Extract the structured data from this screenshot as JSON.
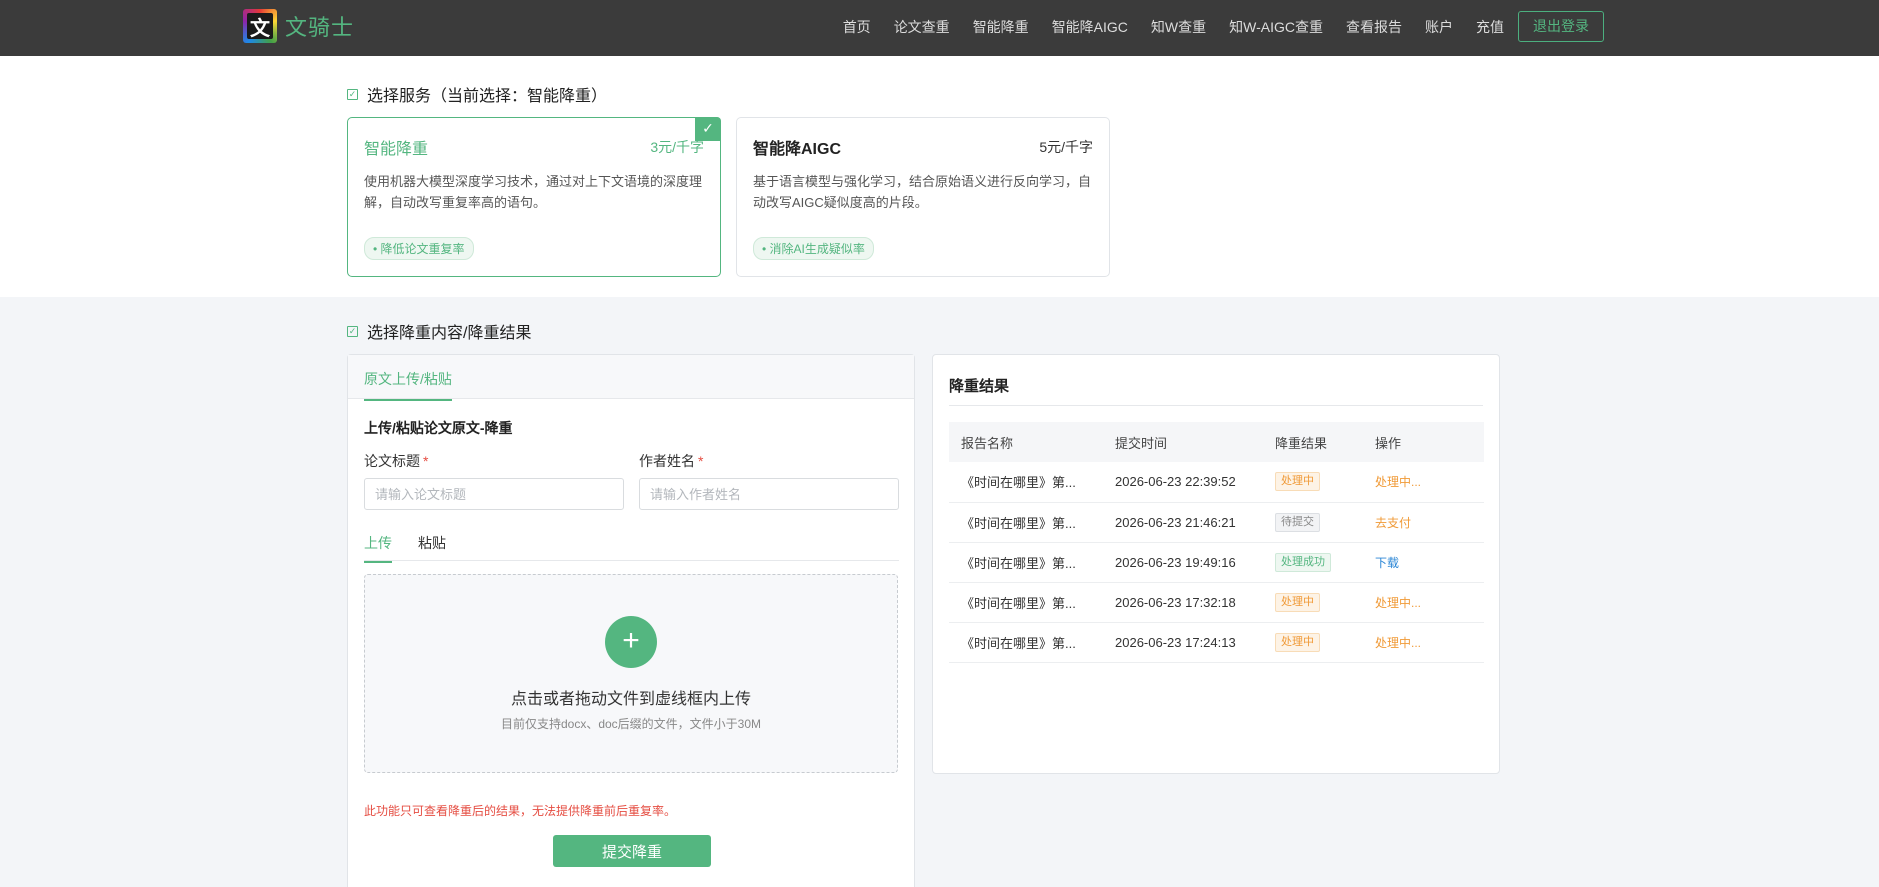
{
  "header": {
    "logo_glyph": "文",
    "brand": "文骑士",
    "nav": [
      "首页",
      "论文查重",
      "智能降重",
      "智能降AIGC",
      "知W查重",
      "知W-AIGC查重",
      "查看报告",
      "账户",
      "充值"
    ],
    "logout_label": "退出登录"
  },
  "service_section": {
    "title": "选择服务（当前选择：智能降重）",
    "cards": [
      {
        "name": "智能降重",
        "price": "3元/千字",
        "desc": "使用机器大模型深度学习技术，通过对上下文语境的深度理解，自动改写重复率高的语句。",
        "tag": "• 降低论文重复率",
        "selected": true
      },
      {
        "name": "智能降AIGC",
        "price": "5元/千字",
        "desc": "基于语言模型与强化学习，结合原始语义进行反向学习，自动改写AIGC疑似度高的片段。",
        "tag": "• 消除AI生成疑似率",
        "selected": false
      }
    ],
    "check_mark": "✓"
  },
  "content_section": {
    "title": "选择降重内容/降重结果",
    "panel_tab": "原文上传/粘贴",
    "subtitle": "上传/粘贴论文原文-降重",
    "title_label": "论文标题",
    "title_placeholder": "请输入论文标题",
    "author_label": "作者姓名",
    "author_placeholder": "请输入作者姓名",
    "required_mark": "*",
    "mode_tabs": [
      "上传",
      "粘贴"
    ],
    "plus": "+",
    "drop_main": "点击或者拖动文件到虚线框内上传",
    "drop_sub": "目前仅支持docx、doc后缀的文件，文件小于30M",
    "warning": "此功能只可查看降重后的结果，无法提供降重前后重复率。",
    "submit_label": "提交降重"
  },
  "results": {
    "title": "降重结果",
    "columns": [
      "报告名称",
      "提交时间",
      "降重结果",
      "操作"
    ],
    "rows": [
      {
        "name": "《时间在哪里》第...",
        "time": "2026-06-23 22:39:52",
        "status": "处理中",
        "status_type": "processing",
        "action": "处理中...",
        "action_type": "orange"
      },
      {
        "name": "《时间在哪里》第...",
        "time": "2026-06-23 21:46:21",
        "status": "待提交",
        "status_type": "pending",
        "action": "去支付",
        "action_type": "orange"
      },
      {
        "name": "《时间在哪里》第...",
        "time": "2026-06-23 19:49:16",
        "status": "处理成功",
        "status_type": "success",
        "action": "下载",
        "action_type": "blue"
      },
      {
        "name": "《时间在哪里》第...",
        "time": "2026-06-23 17:32:18",
        "status": "处理中",
        "status_type": "processing",
        "action": "处理中...",
        "action_type": "orange"
      },
      {
        "name": "《时间在哪里》第...",
        "time": "2026-06-23 17:24:13",
        "status": "处理中",
        "status_type": "processing",
        "action": "处理中...",
        "action_type": "orange"
      }
    ]
  },
  "colors": {
    "accent": "#54b680",
    "header_bg": "#3b3b3b",
    "warning": "#e54d42",
    "processing": "#f09a37",
    "link": "#2c87d6"
  }
}
